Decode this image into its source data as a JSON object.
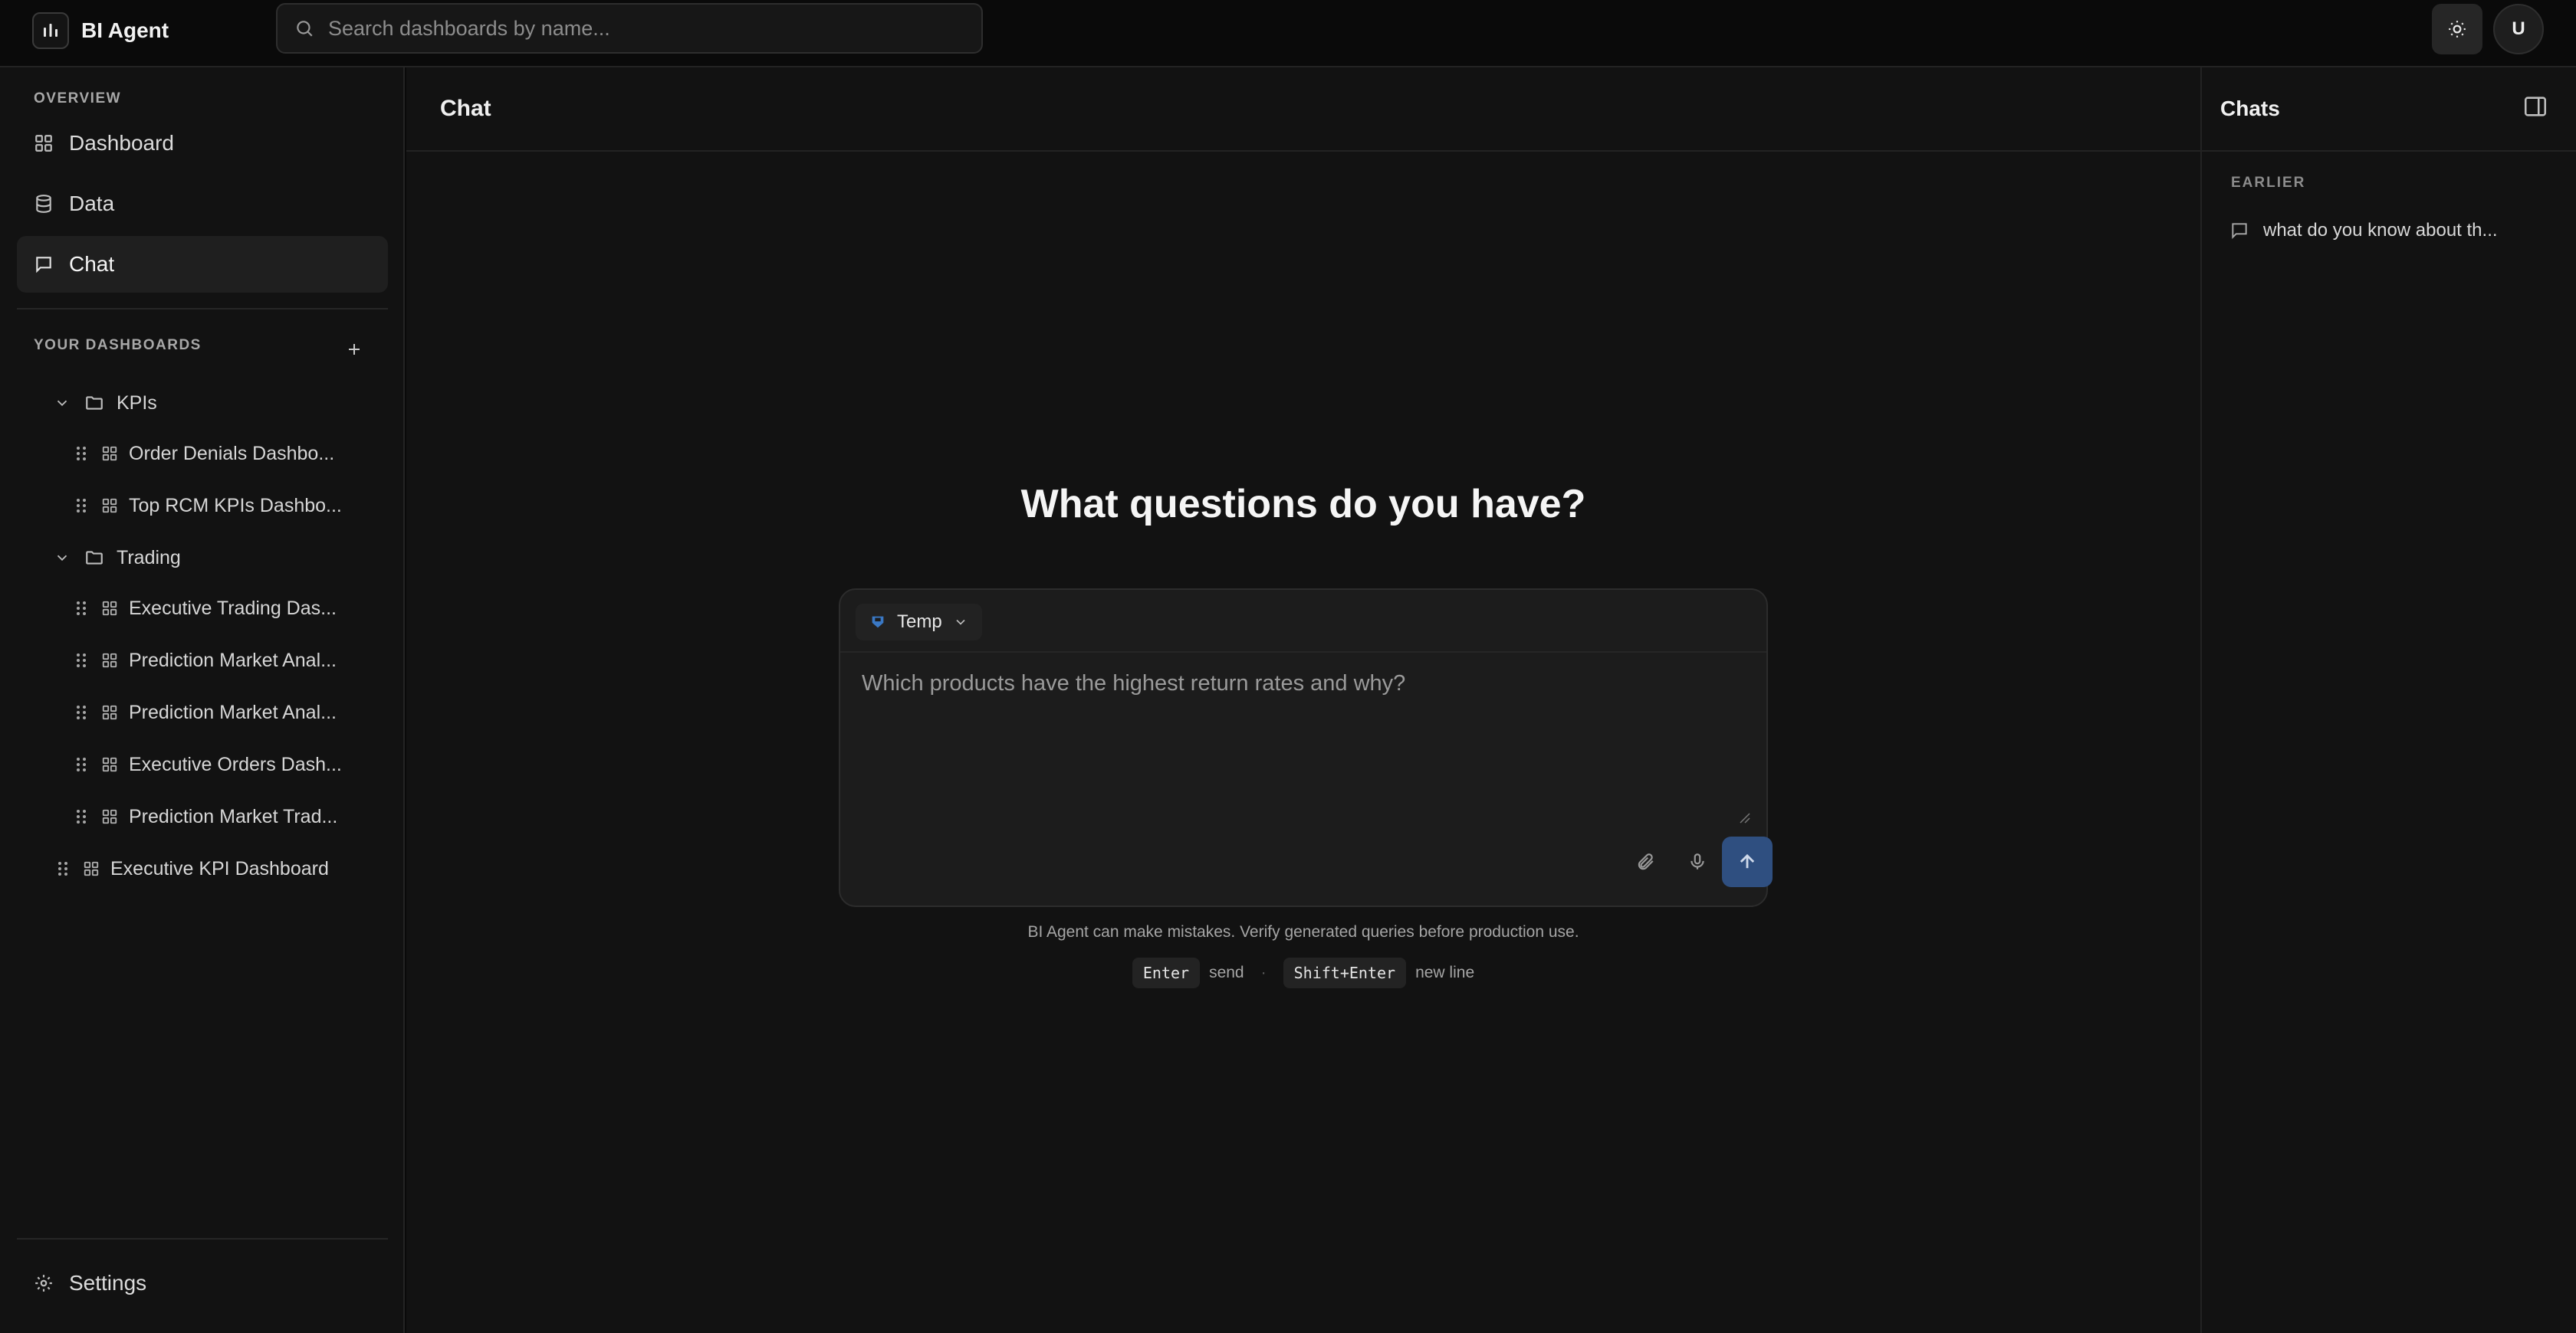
{
  "app": {
    "name": "BI Agent"
  },
  "search": {
    "placeholder": "Search dashboards by name..."
  },
  "user": {
    "initial": "U"
  },
  "sidebar": {
    "overview_label": "OVERVIEW",
    "nav": [
      {
        "label": "Dashboard",
        "icon": "grid-icon"
      },
      {
        "label": "Data",
        "icon": "database-icon"
      },
      {
        "label": "Chat",
        "icon": "chat-icon",
        "active": true
      }
    ],
    "dashboards_label": "YOUR DASHBOARDS",
    "folders": [
      {
        "name": "KPIs",
        "items": [
          "Order Denials Dashbo...",
          "Top RCM KPIs Dashbo..."
        ]
      },
      {
        "name": "Trading",
        "items": [
          "Executive Trading Das...",
          "Prediction Market Anal...",
          "Prediction Market Anal...",
          "Executive Orders Dash...",
          "Prediction Market Trad..."
        ]
      }
    ],
    "root_items": [
      "Executive KPI Dashboard"
    ],
    "settings_label": "Settings"
  },
  "main": {
    "title": "Chat",
    "hero": "What questions do you have?",
    "source": {
      "label": "Temp"
    },
    "input_placeholder": "Which products have the highest return rates and why?",
    "disclaimer": "BI Agent can make mistakes. Verify generated queries before production use.",
    "hints": {
      "send_key": "Enter",
      "send_label": "send",
      "newline_key": "Shift+Enter",
      "newline_label": "new line",
      "separator": "·"
    }
  },
  "chats_panel": {
    "title": "Chats",
    "section_label": "EARLIER",
    "items": [
      "what do you know about th..."
    ]
  },
  "colors": {
    "background": "#0a0a0a",
    "panel": "#121212",
    "send_button": "#2f4f80"
  }
}
